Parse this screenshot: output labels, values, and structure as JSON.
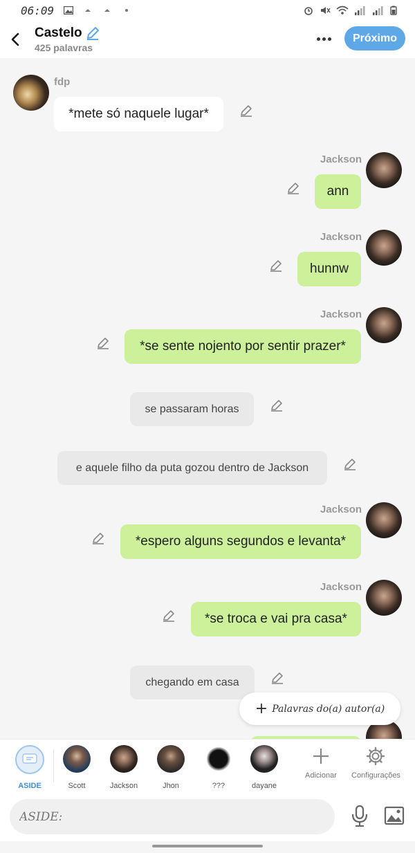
{
  "status_bar": {
    "time": "06:09"
  },
  "header": {
    "title": "Castelo",
    "subtitle": "425 palavras",
    "next_label": "Próximo"
  },
  "messages": [
    {
      "type": "char",
      "side": "left",
      "name": "fdp",
      "text": "*mete só naquele lugar*"
    },
    {
      "type": "char",
      "side": "right",
      "name": "Jackson",
      "text": "ann"
    },
    {
      "type": "char",
      "side": "right",
      "name": "Jackson",
      "text": "hunnw"
    },
    {
      "type": "char",
      "side": "right",
      "name": "Jackson",
      "text": "*se sente nojento por sentir prazer*"
    },
    {
      "type": "aside",
      "text": "se passaram horas"
    },
    {
      "type": "aside",
      "text": "e aquele filho da puta gozou dentro de Jackson"
    },
    {
      "type": "char",
      "side": "right",
      "name": "Jackson",
      "text": "*espero alguns segundos e levanta*"
    },
    {
      "type": "char",
      "side": "right",
      "name": "Jackson",
      "text": "*se troca e vai pra casa*"
    },
    {
      "type": "aside",
      "text": "chegando em casa"
    },
    {
      "type": "char",
      "side": "right",
      "name": "Jackson",
      "text": ""
    }
  ],
  "float_button": {
    "label": "Palavras do(a) autor(a)"
  },
  "characters": [
    {
      "label": "ASIDE"
    },
    {
      "label": "Scott"
    },
    {
      "label": "Jackson"
    },
    {
      "label": "Jhon"
    },
    {
      "label": "???"
    },
    {
      "label": "dayane"
    }
  ],
  "tools": {
    "add_label": "Adicionar",
    "settings_label": "Configurações"
  },
  "input": {
    "placeholder": "ASIDE:"
  },
  "colors": {
    "accent": "#5fa8e8",
    "user_bubble": "#cdf09a",
    "aside_bubble": "#e9e9e9",
    "other_bubble": "#ffffff"
  }
}
